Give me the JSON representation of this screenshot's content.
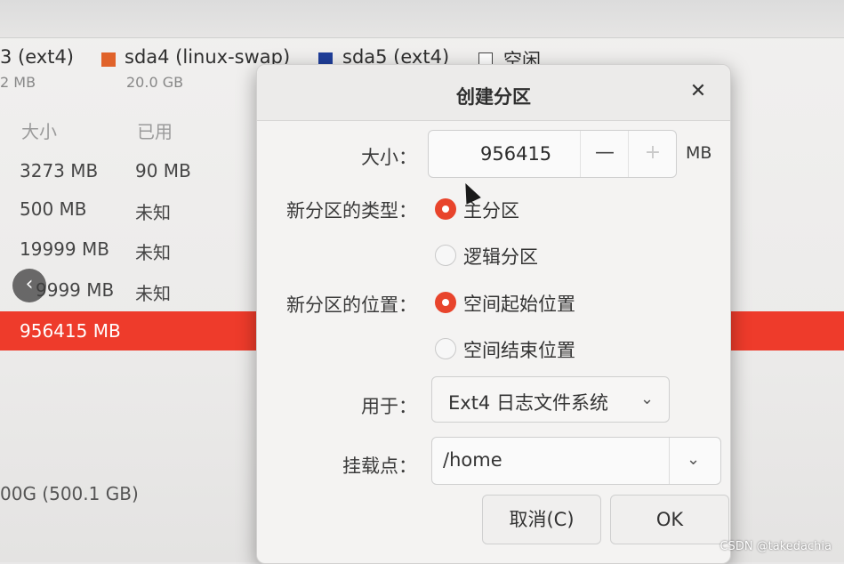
{
  "background": {
    "legend": [
      {
        "label": "3 (ext4)",
        "color": "",
        "size": "2 MB"
      },
      {
        "label": "sda4 (linux-swap)",
        "color": "#e0622a",
        "size": "20.0 GB"
      },
      {
        "label": "sda5 (ext4)",
        "color": "#1f3e9a",
        "size": ""
      },
      {
        "label": "空闲",
        "color": "",
        "size": ""
      }
    ],
    "table": {
      "headers": [
        "大小",
        "已用"
      ],
      "rows": [
        {
          "size": "3273 MB",
          "used": "90 MB"
        },
        {
          "size": "500 MB",
          "used": "未知"
        },
        {
          "size": "19999 MB",
          "used": "未知"
        },
        {
          "size": "9999 MB",
          "used": "未知"
        },
        {
          "size": "956415 MB",
          "used": ""
        }
      ]
    },
    "disk_size": "00G (500.1 GB)",
    "nav_icon": "chevron-left",
    "watermark": "CSDN @takedachia",
    "selected_color": "#ee3b2b"
  },
  "dialog": {
    "title": "创建分区",
    "close_icon": "close",
    "size_label": "大小：",
    "size_value": "956415",
    "size_minus": "—",
    "size_plus": "+",
    "size_unit": "MB",
    "type_label": "新分区的类型：",
    "type_options": [
      "主分区",
      "逻辑分区"
    ],
    "type_selected": "主分区",
    "position_label": "新分区的位置：",
    "position_options": [
      "空间起始位置",
      "空间结束位置"
    ],
    "position_selected": "空间起始位置",
    "fs_label": "用于：",
    "fs_value": "Ext4 日志文件系统",
    "mount_label": "挂载点：",
    "mount_value": "/home",
    "cancel_label": "取消(C)",
    "ok_label": "OK",
    "accent": "#e8442c"
  }
}
